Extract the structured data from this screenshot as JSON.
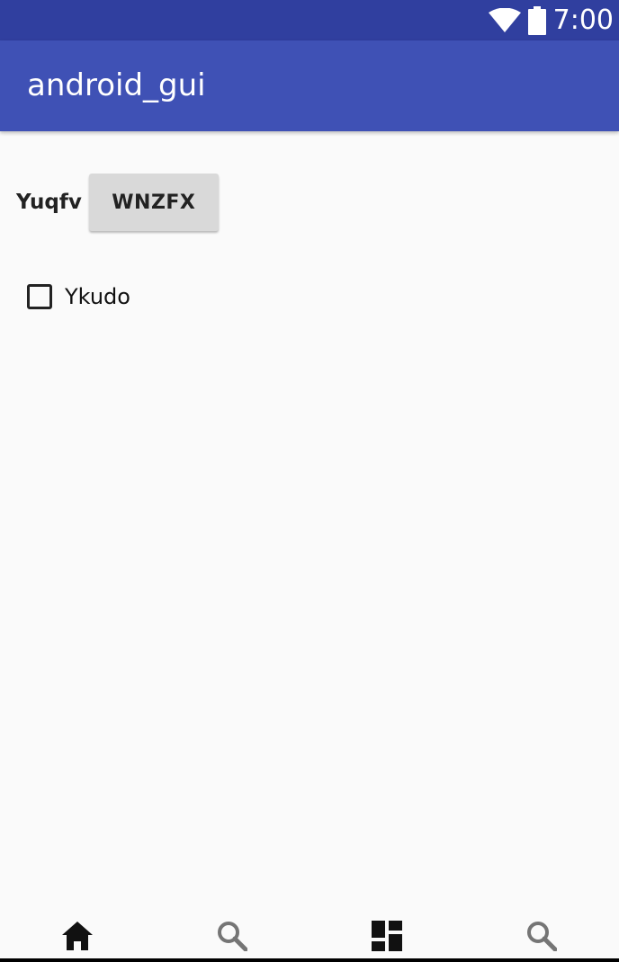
{
  "status_bar": {
    "time": "7:00",
    "icons": [
      "wifi-icon",
      "battery-icon"
    ]
  },
  "app_bar": {
    "title": "android_gui"
  },
  "content": {
    "label": "Yuqfv",
    "button_label": "WNZFX",
    "checkbox": {
      "label": "Ykudo",
      "checked": false
    }
  },
  "bottom_nav": {
    "items": [
      {
        "icon": "home-icon",
        "active": true
      },
      {
        "icon": "search-icon",
        "active": false
      },
      {
        "icon": "dashboard-icon",
        "active": false
      },
      {
        "icon": "search-icon",
        "active": false
      }
    ]
  },
  "colors": {
    "status_bar": "#303f9f",
    "primary": "#3f51b5",
    "background": "#fafafa",
    "button": "#d9d9d9",
    "nav_active": "#111111",
    "nav_inactive": "#757575"
  }
}
